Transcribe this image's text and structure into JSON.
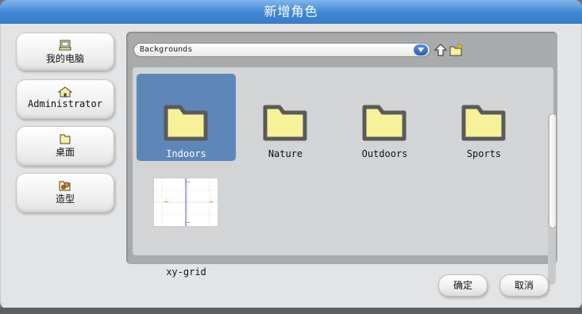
{
  "dialog": {
    "title": "新增角色"
  },
  "sidebar": {
    "items": [
      {
        "label": "我的电脑",
        "icon": "computer-icon"
      },
      {
        "label": "Administrator",
        "icon": "home-icon"
      },
      {
        "label": "桌面",
        "icon": "folder-icon"
      },
      {
        "label": "造型",
        "icon": "costume-folder-icon"
      }
    ]
  },
  "browser": {
    "path": "Backgrounds",
    "items": [
      {
        "name": "Indoors",
        "type": "folder",
        "selected": true
      },
      {
        "name": "Nature",
        "type": "folder"
      },
      {
        "name": "Outdoors",
        "type": "folder"
      },
      {
        "name": "Sports",
        "type": "folder"
      },
      {
        "name": "xy-grid",
        "type": "image"
      }
    ]
  },
  "footer": {
    "ok_label": "确定",
    "cancel_label": "取消"
  },
  "colors": {
    "titlebar": "#3f86d3",
    "selection": "#5d86b9",
    "folder_fill": "#f7f29a",
    "folder_stroke": "#5a5a5a"
  }
}
